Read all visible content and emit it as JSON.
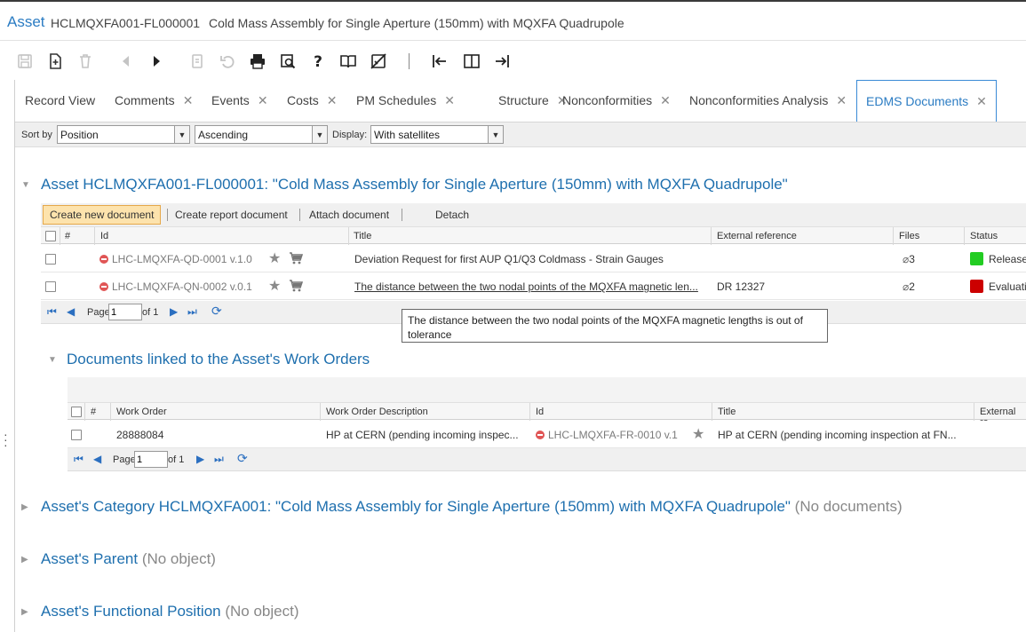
{
  "title_bar": {
    "entity": "Asset",
    "code": "HCLMQXFA001-FL000001",
    "description": "Cold Mass Assembly for Single Aperture (150mm) with MQXFA Quadrupole"
  },
  "toolbar": {
    "icons": [
      "save-icon",
      "new-record-icon",
      "delete-icon",
      "previous-icon",
      "next-icon",
      "copy-icon",
      "undo-icon",
      "print-icon",
      "print-preview-icon",
      "help-icon",
      "book-icon",
      "disable-icon",
      "first-record-icon",
      "split-view-icon",
      "last-record-icon"
    ]
  },
  "tabs": [
    {
      "label": "Record View",
      "closable": false
    },
    {
      "label": "Comments",
      "closable": true
    },
    {
      "label": "Events",
      "closable": true
    },
    {
      "label": "Costs",
      "closable": true
    },
    {
      "label": "PM Schedules",
      "closable": true
    },
    {
      "label": "Structure",
      "closable": true
    },
    {
      "label": "Nonconformities",
      "closable": true
    },
    {
      "label": "Nonconformities Analysis",
      "closable": true
    },
    {
      "label": "EDMS Documents",
      "closable": true,
      "active": true
    }
  ],
  "close_glyph": "✕",
  "sortbar": {
    "sort_by_label": "Sort by",
    "sort_by_value": "Position",
    "order_value": "Ascending",
    "display_label": "Display:",
    "display_value": "With satellites"
  },
  "asset_section": {
    "title": "Asset HCLMQXFA001-FL000001: \"Cold Mass Assembly for Single Aperture (150mm) with MQXFA Quadrupole\"",
    "actions": {
      "create_new": "Create new document",
      "create_report": "Create report document",
      "attach": "Attach document",
      "detach": "Detach"
    },
    "columns": {
      "num": "#",
      "id": "Id",
      "title": "Title",
      "external": "External reference",
      "files": "Files",
      "status": "Status"
    },
    "rows": [
      {
        "id": "LHC-LMQXFA-QD-0001 v.1.0",
        "title": "Deviation Request for first AUP Q1/Q3 Coldmass - Strain Gauges",
        "external": "",
        "files": "3",
        "status": "Released",
        "status_color": "#22cc22"
      },
      {
        "id": "LHC-LMQXFA-QN-0002 v.0.1",
        "title": "The distance between the two nodal points of the MQXFA magnetic len...",
        "external": "DR 12327",
        "files": "2",
        "status": "Evaluation",
        "status_color": "#cc0000"
      }
    ],
    "pager": {
      "page_label": "Page",
      "page_value": "1",
      "of_label": "of 1"
    }
  },
  "tooltip": {
    "text": "The distance between the two nodal points of the MQXFA magnetic lengths is out of tolerance"
  },
  "work_orders_section": {
    "title": "Documents linked to the Asset's Work Orders",
    "columns": {
      "num": "#",
      "work_order": "Work Order",
      "wo_desc": "Work Order Description",
      "id": "Id",
      "title": "Title",
      "external": "External re"
    },
    "rows": [
      {
        "work_order": "28888084",
        "wo_desc": "HP at CERN (pending incoming inspec...",
        "id": "LHC-LMQXFA-FR-0010 v.1",
        "title": "HP at CERN (pending incoming inspection at FN..."
      }
    ],
    "pager": {
      "page_label": "Page",
      "page_value": "1",
      "of_label": "of 1"
    }
  },
  "category_section": {
    "title": "Asset's Category HCLMQXFA001: \"Cold Mass Assembly for Single Aperture (150mm) with MQXFA Quadrupole\"",
    "note": "(No documents)"
  },
  "parent_section": {
    "title": "Asset's Parent",
    "note": "(No object)"
  },
  "functional_section": {
    "title": "Asset's Functional Position",
    "note": "(No object)"
  },
  "colors": {
    "accent": "#2b7cc3",
    "title_blue": "#1e6fae",
    "primary_button": "#fde3ad"
  }
}
